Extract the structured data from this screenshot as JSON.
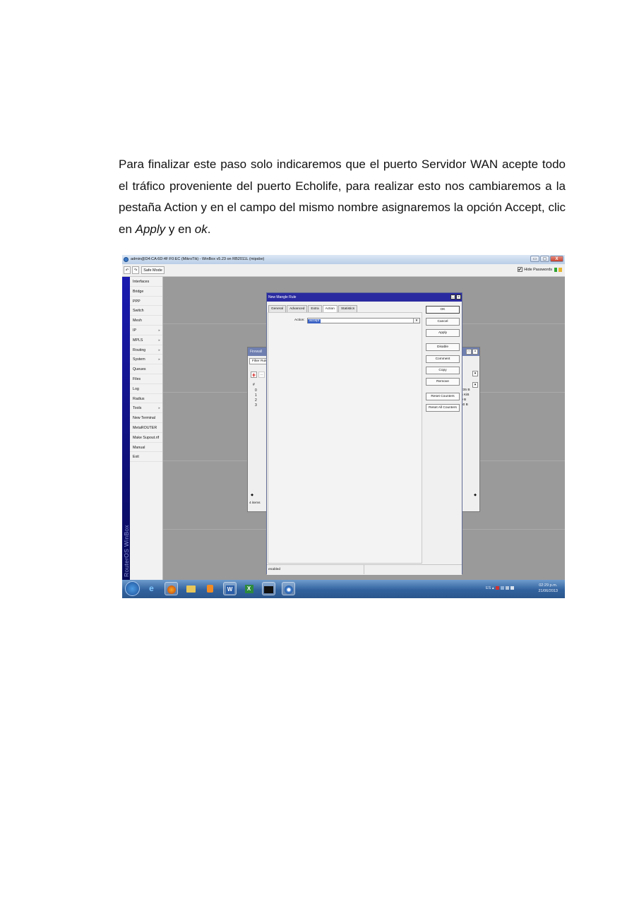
{
  "paragraph": {
    "part1": "Para finalizar este paso solo indicaremos que el puerto Servidor WAN acepte todo el tráfico proveniente del puerto Echolife, para realizar esto nos cambiaremos a la pestaña Action y en el campo del mismo nombre asignaremos la opción Accept, clic en ",
    "apply": "Apply",
    "part2": " y en ",
    "ok": "ok",
    "part3": "."
  },
  "window": {
    "title": "admin@D4:CA:6D:4F:F0:EC (MikroTik) - WinBox v5.23 on RB2011L (mipsbe)",
    "controls": [
      "▭",
      "▢",
      "X"
    ]
  },
  "toolbar": {
    "undo": "↶",
    "redo": "↷",
    "safe_mode": "Safe Mode",
    "hide_passwords": "Hide Passwords"
  },
  "brand": "RouterOS WinBox",
  "menu": [
    {
      "label": "Interfaces",
      "sub": false
    },
    {
      "label": "Bridge",
      "sub": false
    },
    {
      "label": "PPP",
      "sub": false
    },
    {
      "label": "Switch",
      "sub": false
    },
    {
      "label": "Mesh",
      "sub": false
    },
    {
      "label": "IP",
      "sub": true
    },
    {
      "label": "MPLS",
      "sub": true
    },
    {
      "label": "Routing",
      "sub": true
    },
    {
      "label": "System",
      "sub": true
    },
    {
      "label": "Queues",
      "sub": false
    },
    {
      "label": "Files",
      "sub": false
    },
    {
      "label": "Log",
      "sub": false
    },
    {
      "label": "Radius",
      "sub": false
    },
    {
      "label": "Tools",
      "sub": true
    },
    {
      "label": "New Terminal",
      "sub": false
    },
    {
      "label": "MetaROUTER",
      "sub": false
    },
    {
      "label": "Make Supout.rif",
      "sub": false
    },
    {
      "label": "Manual",
      "sub": false
    },
    {
      "label": "Exit",
      "sub": false
    }
  ],
  "firewall": {
    "title": "Firewall",
    "tab": "Filter Rule",
    "hash": "#",
    "rows": [
      "0",
      "1",
      "2",
      "3"
    ],
    "right_values": [
      "235 B",
      "5 KiB",
      "0 B",
      "60 B"
    ],
    "items": "4 items"
  },
  "mangle": {
    "title": "New Mangle Rule",
    "tabs": [
      {
        "label": "General",
        "active": false
      },
      {
        "label": "Advanced",
        "active": false
      },
      {
        "label": "Extra",
        "active": false
      },
      {
        "label": "Action",
        "active": true
      },
      {
        "label": "Statistics",
        "active": false
      }
    ],
    "action_label": "Action:",
    "action_value": "accept",
    "buttons": [
      "OK",
      "Cancel",
      "Apply",
      "Disable",
      "Comment",
      "Copy",
      "Remove",
      "Reset Counters",
      "Reset All Counters"
    ],
    "status": "enabled"
  },
  "taskbar": {
    "lang": "ES",
    "time": "02:29 p.m.",
    "date": "21/06/2013"
  }
}
